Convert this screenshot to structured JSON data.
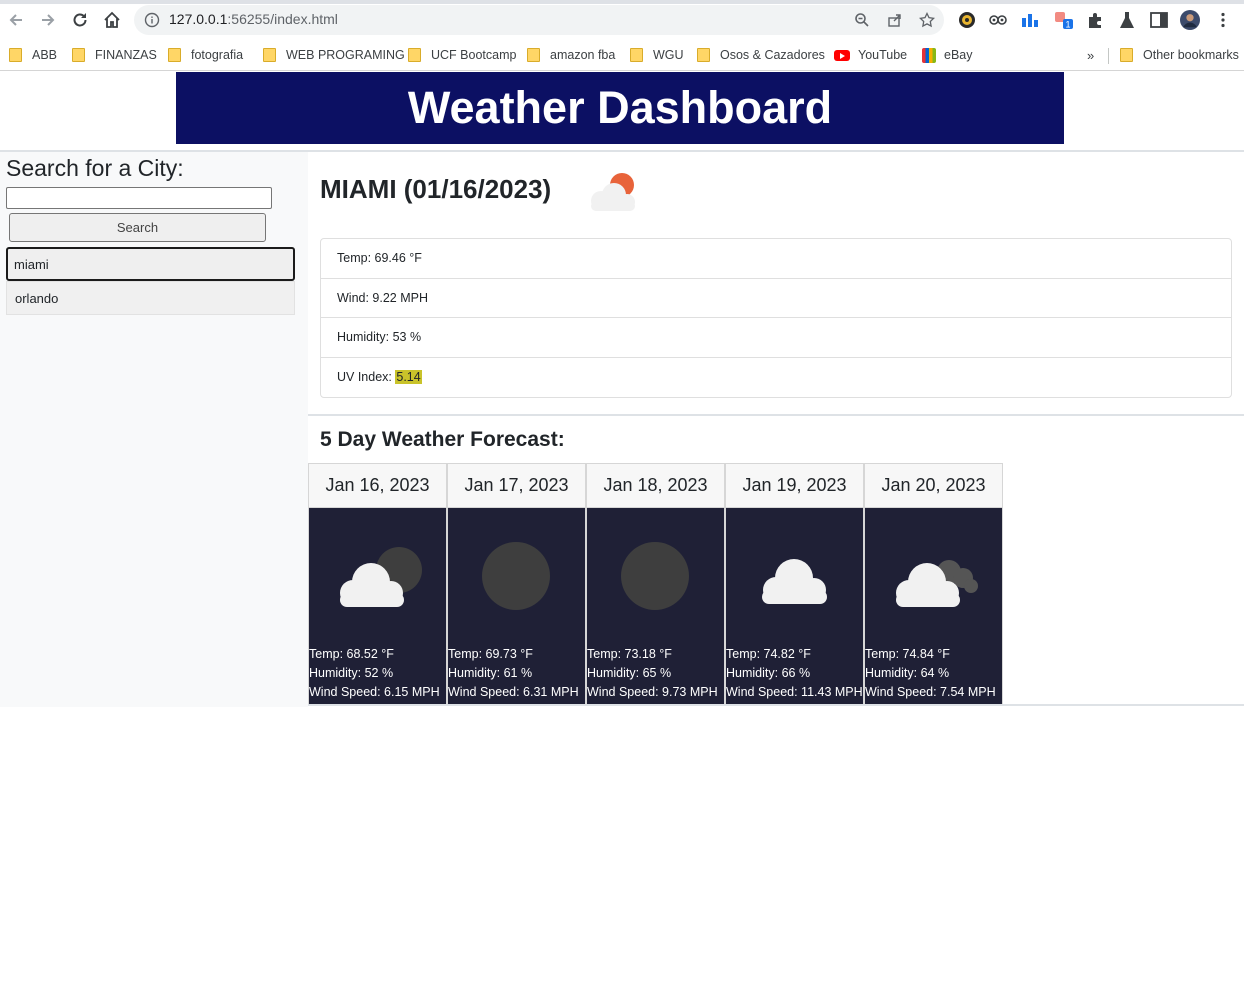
{
  "browser": {
    "url_host": "127.0.0.1",
    "url_rest": ":56255/index.html",
    "bookmarks": [
      "ABB",
      "FINANZAS",
      "fotografia",
      "WEB PROGRAMING",
      "UCF Bootcamp",
      "amazon fba",
      "WGU",
      "Osos & Cazadores",
      "YouTube",
      "eBay"
    ],
    "more_bookmarks": "»",
    "other_bookmarks": "Other bookmarks",
    "extension_badge": "1"
  },
  "page": {
    "header_title": "Weather Dashboard",
    "search_heading": "Search for a City:",
    "search_input_value": "",
    "search_button_label": "Search",
    "history": [
      "miami",
      "orlando"
    ],
    "current": {
      "title": "MIAMI (01/16/2023)",
      "icon": "few-clouds-icon",
      "temp": "Temp: 69.46 °F",
      "wind": "Wind: 9.22 MPH",
      "humidity": "Humidity: 53 %",
      "uv_label": "UV Index: ",
      "uv_value": "5.14",
      "uv_color": "#c9c32a"
    },
    "forecast_title": "5 Day Weather Forecast:",
    "forecast": [
      {
        "date": "Jan 16, 2023",
        "icon": "cloudy-night-icon",
        "temp": "Temp: 68.52 °F",
        "humidity": "Humidity: 52 %",
        "wind": "Wind Speed: 6.15 MPH"
      },
      {
        "date": "Jan 17, 2023",
        "icon": "clear-night-icon",
        "temp": "Temp: 69.73 °F",
        "humidity": "Humidity: 61 %",
        "wind": "Wind Speed: 6.31 MPH"
      },
      {
        "date": "Jan 18, 2023",
        "icon": "clear-night-icon",
        "temp": "Temp: 73.18 °F",
        "humidity": "Humidity: 65 %",
        "wind": "Wind Speed: 9.73 MPH"
      },
      {
        "date": "Jan 19, 2023",
        "icon": "cloud-icon",
        "temp": "Temp: 74.82 °F",
        "humidity": "Humidity: 66 %",
        "wind": "Wind Speed: 11.43 MPH"
      },
      {
        "date": "Jan 20, 2023",
        "icon": "broken-clouds-icon",
        "temp": "Temp: 74.84 °F",
        "humidity": "Humidity: 64 %",
        "wind": "Wind Speed: 7.54 MPH"
      }
    ],
    "colors": {
      "header_bg": "#0c1063",
      "card_bg": "#1f2036"
    }
  }
}
